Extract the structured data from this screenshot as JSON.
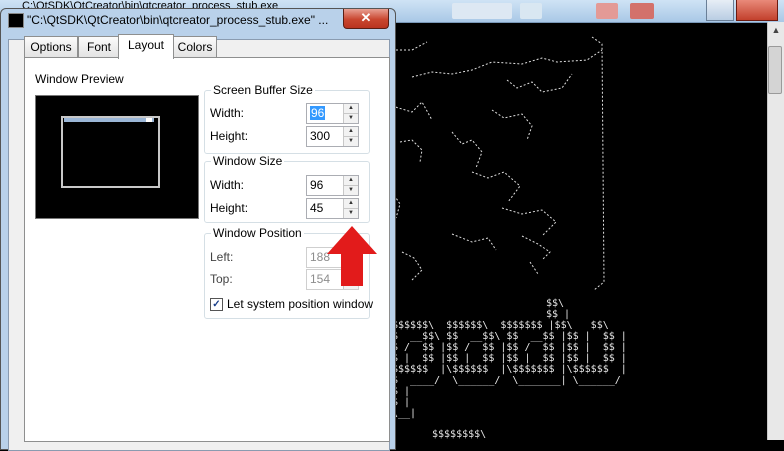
{
  "console": {
    "title": "C:\\QtSDK\\QtCreator\\bin\\qtcreator_process_stub.exe"
  },
  "dialog": {
    "title": "\"C:\\QtSDK\\QtCreator\\bin\\qtcreator_process_stub.exe\" ...",
    "close_glyph": "✕",
    "tabs": [
      {
        "label": "Options"
      },
      {
        "label": "Font"
      },
      {
        "label": "Layout",
        "active": true
      },
      {
        "label": "Colors"
      }
    ],
    "preview_label": "Window Preview",
    "buffer": {
      "title": "Screen Buffer Size",
      "width_label": "Width:",
      "width_value": "96",
      "height_label": "Height:",
      "height_value": "300"
    },
    "window_size": {
      "title": "Window Size",
      "width_label": "Width:",
      "width_value": "96",
      "height_label": "Height:",
      "height_value": "45"
    },
    "window_position": {
      "title": "Window Position",
      "left_label": "Left:",
      "left_value": "188",
      "top_label": "Top:",
      "top_value": "154",
      "checkbox_label": "Let system position window",
      "checkbox_checked": true,
      "check_glyph": "✓"
    },
    "spin_up": "▲",
    "spin_down": "▼"
  },
  "annotation": {
    "arrow_color": "#e21b1b"
  },
  "colors": {
    "title_gradient_top": "#cfe3f5",
    "close_red": "#c9462f",
    "selection_blue": "#3399ff"
  }
}
